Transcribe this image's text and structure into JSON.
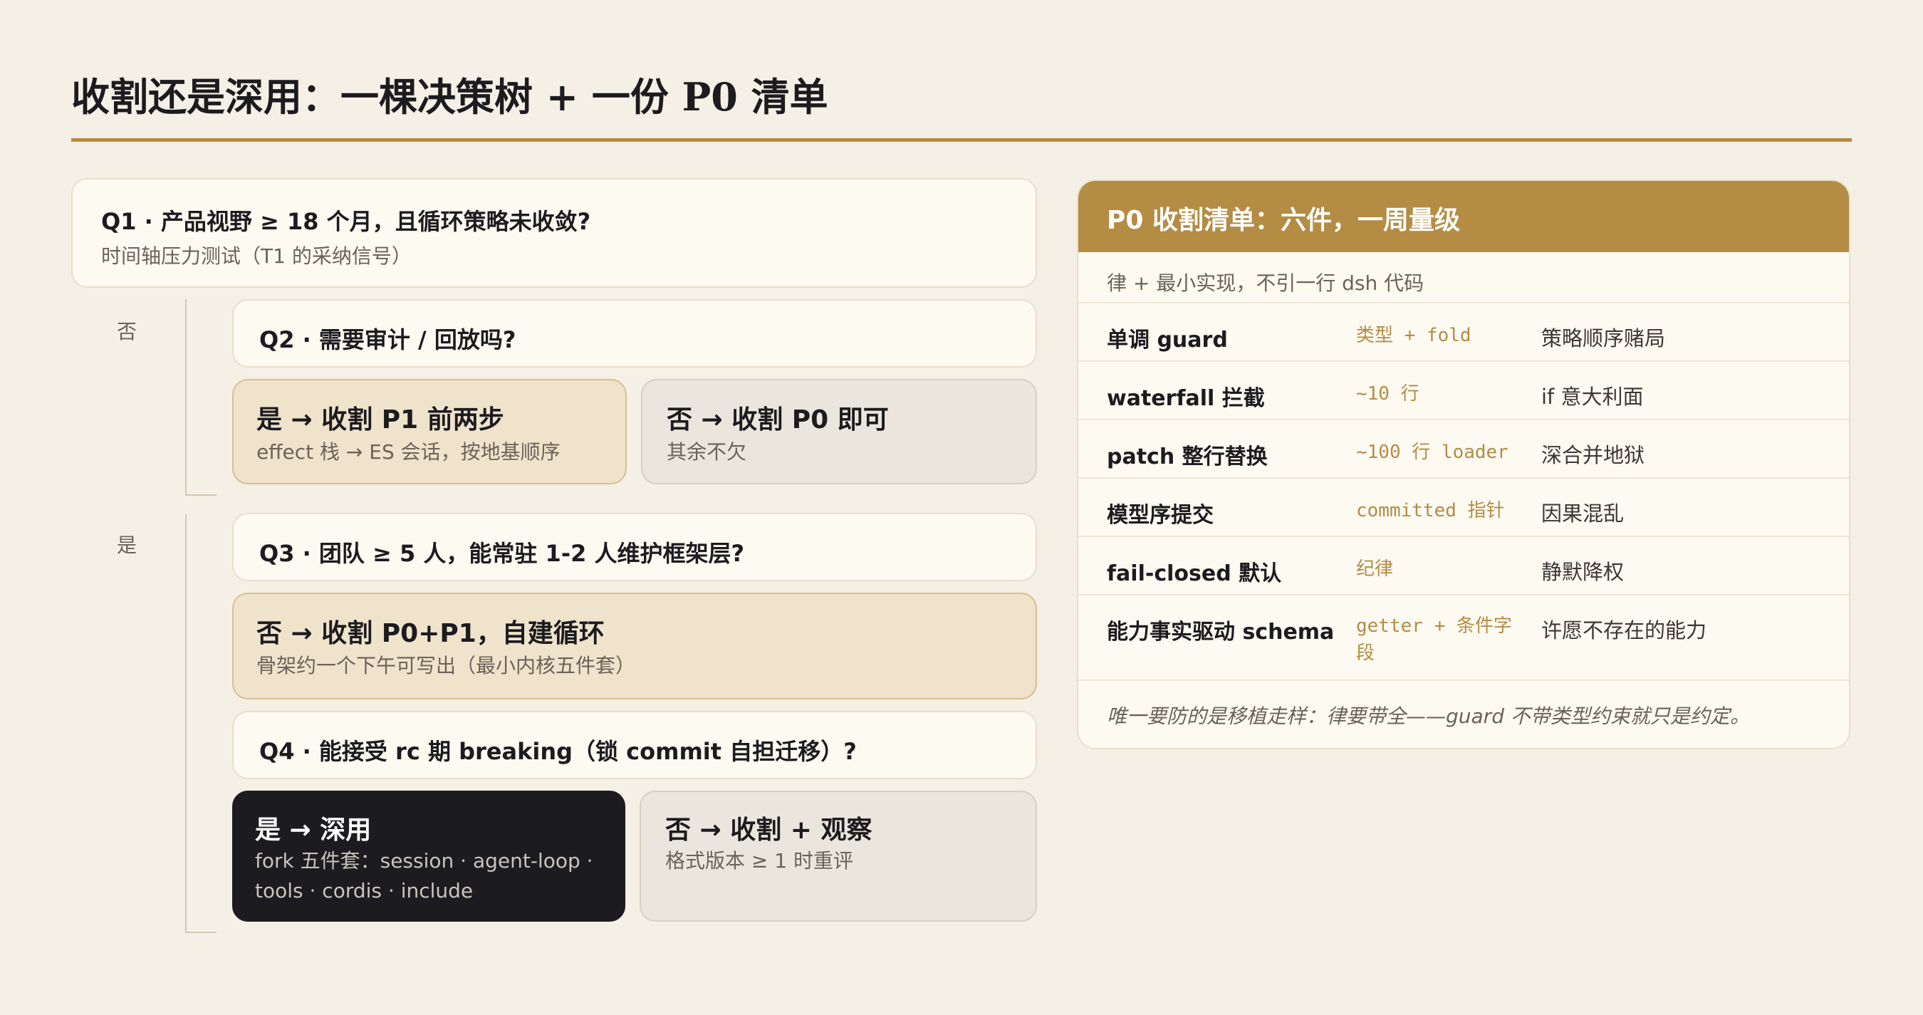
{
  "title": "收割还是深用：一棵决策树 + 一份 P0 清单",
  "tree": {
    "q1": {
      "title": "Q1 · 产品视野 ≥ 18 个月，且循环策略未收敛?",
      "sub": "时间轴压力测试（T1 的采纳信号）"
    },
    "branch_no": "否",
    "q2": {
      "title": "Q2 · 需要审计 / 回放吗?"
    },
    "q2_yes": {
      "title": "是 → 收割 P1 前两步",
      "sub": "effect 栈 → ES 会话，按地基顺序"
    },
    "q2_no": {
      "title": "否 → 收割 P0 即可",
      "sub": "其余不欠"
    },
    "branch_yes": "是",
    "q3": {
      "title": "Q3 · 团队 ≥ 5 人，能常驻 1-2 人维护框架层?"
    },
    "q3_no": {
      "title": "否 → 收割 P0+P1，自建循环",
      "sub": "骨架约一个下午可写出（最小内核五件套）"
    },
    "q4": {
      "title": "Q4 · 能接受 rc 期 breaking（锁 commit 自担迁移）?"
    },
    "q4_yes": {
      "title": "是 → 深用",
      "sub": "fork 五件套：session · agent-loop · tools · cordis · include"
    },
    "q4_no": {
      "title": "否 → 收割 + 观察",
      "sub": "格式版本 ≥ 1 时重评"
    }
  },
  "checklist": {
    "title": "P0 收割清单：六件，一周量级",
    "subtitle": "律 + 最小实现，不引一行 dsh 代码",
    "rows": [
      {
        "item": "单调 guard",
        "cost": "类型 + fold",
        "risk": "策略顺序赌局"
      },
      {
        "item": "waterfall 拦截",
        "cost": "~10 行",
        "risk": "if 意大利面"
      },
      {
        "item": "patch 整行替换",
        "cost": "~100 行 loader",
        "risk": "深合并地狱"
      },
      {
        "item": "模型序提交",
        "cost": "committed 指针",
        "risk": "因果混乱"
      },
      {
        "item": "fail-closed 默认",
        "cost": "纪律",
        "risk": "静默降权"
      },
      {
        "item": "能力事实驱动 schema",
        "cost": "getter + 条件字段",
        "risk": "许愿不存在的能力"
      }
    ],
    "footer": "唯一要防的是移植走样：律要带全——guard 不带类型约束就只是约定。"
  },
  "colors": {
    "accent": "#b48c44",
    "background": "#f5f0e6",
    "card": "#fdfaf2",
    "tan_card": "#efe3cc",
    "grey_card": "#ebe6dd",
    "dark_card": "#1c1b1f"
  }
}
